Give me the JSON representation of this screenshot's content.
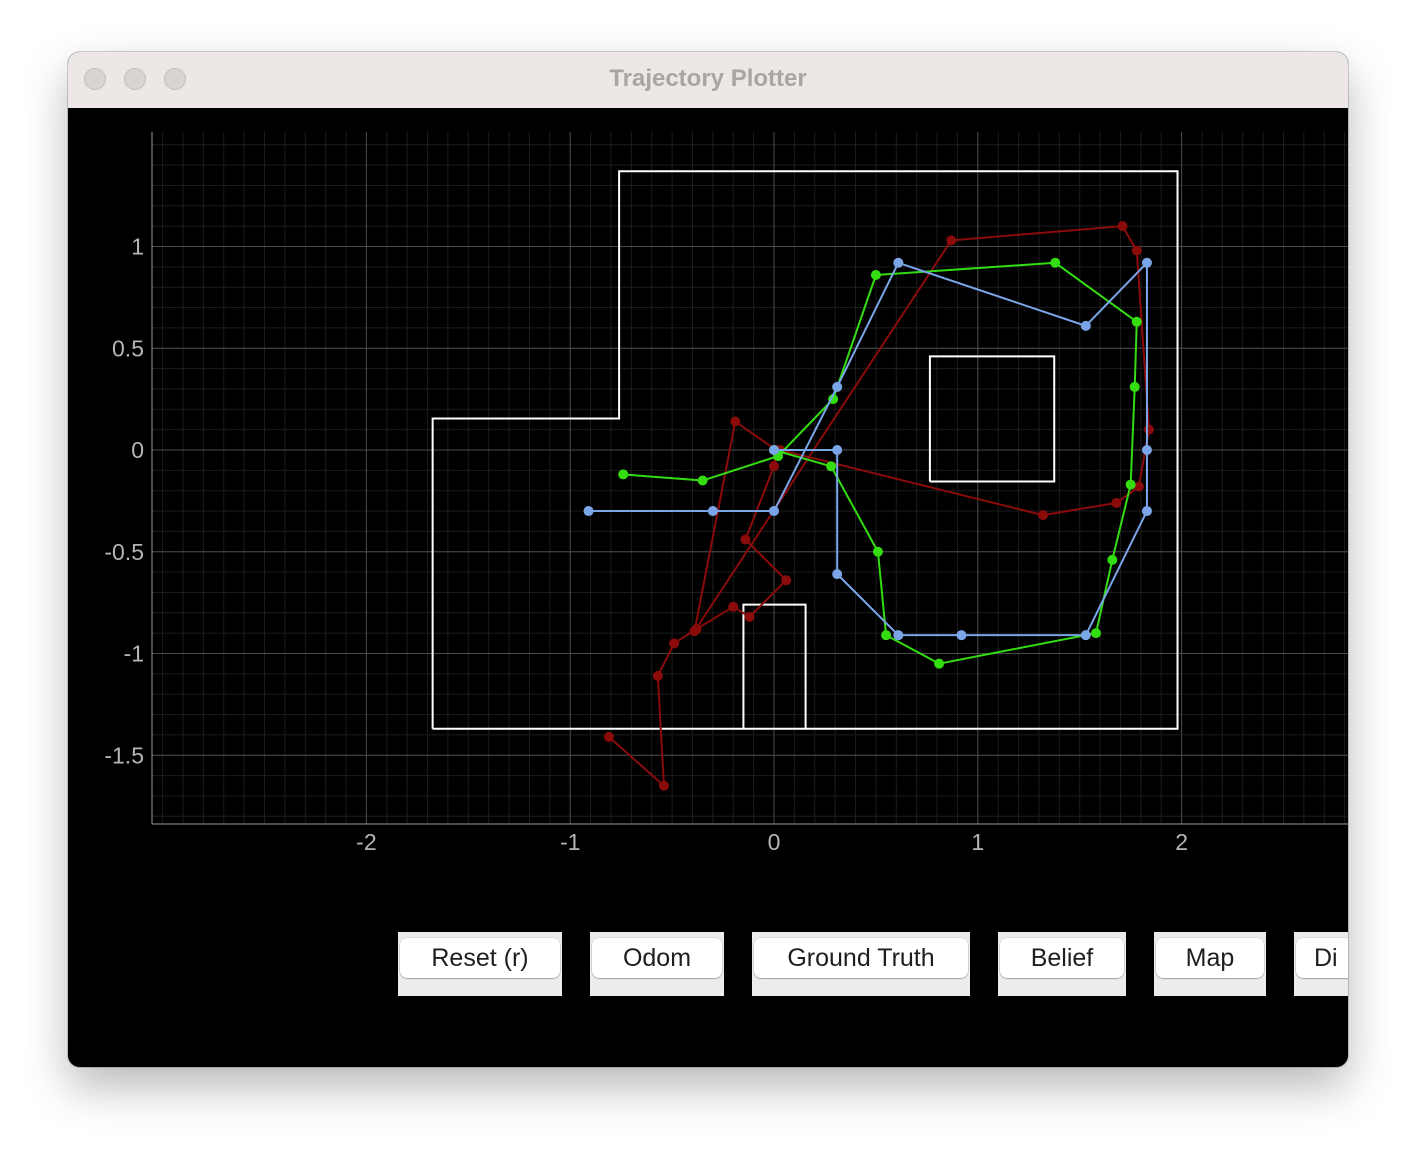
{
  "window": {
    "title": "Trajectory Plotter"
  },
  "colors": {
    "odom": "#8b0a0a",
    "ground_truth": "#33dd11",
    "belief": "#7aa6e8",
    "map": "#ffffff",
    "background": "#000000"
  },
  "buttons": {
    "reset": "Reset (r)",
    "odom": "Odom",
    "ground_truth": "Ground Truth",
    "belief": "Belief",
    "map": "Map",
    "distribution": "Di"
  },
  "chart_data": {
    "type": "line",
    "title": "",
    "xlabel": "",
    "ylabel": "",
    "xlim": [
      -3.0,
      2.8
    ],
    "ylim": [
      -1.83,
      1.55
    ],
    "grid": true,
    "x_ticks": [
      {
        "value": -2,
        "label": "-2"
      },
      {
        "value": -1,
        "label": "-1"
      },
      {
        "value": 0,
        "label": "0"
      },
      {
        "value": 1,
        "label": "1"
      },
      {
        "value": 2,
        "label": "2"
      }
    ],
    "y_ticks": [
      {
        "value": 1,
        "label": "1"
      },
      {
        "value": 0.5,
        "label": "0.5"
      },
      {
        "value": 0,
        "label": "0"
      },
      {
        "value": -0.5,
        "label": "-0.5"
      },
      {
        "value": -1,
        "label": "-1"
      },
      {
        "value": -1.5,
        "label": "-1.5"
      }
    ],
    "map_lines": [
      [
        [
          -1.675,
          -1.37
        ],
        [
          1.98,
          -1.37
        ],
        [
          1.98,
          1.37
        ],
        [
          -0.76,
          1.37
        ],
        [
          -0.76,
          0.155
        ],
        [
          -1.675,
          0.155
        ],
        [
          -1.675,
          -1.37
        ]
      ],
      [
        [
          0.765,
          -0.155
        ],
        [
          1.375,
          -0.155
        ],
        [
          1.375,
          0.46
        ],
        [
          0.765,
          0.46
        ],
        [
          0.765,
          -0.155
        ]
      ],
      [
        [
          -0.15,
          -1.37
        ],
        [
          -0.15,
          -0.76
        ],
        [
          0.155,
          -0.76
        ],
        [
          0.155,
          -1.37
        ]
      ]
    ],
    "series": [
      {
        "key": "odom",
        "points": [
          [
            -0.81,
            -1.41
          ],
          [
            -0.54,
            -1.65
          ],
          [
            -0.57,
            -1.11
          ],
          [
            -0.49,
            -0.95
          ],
          [
            -0.38,
            -0.88
          ],
          [
            -0.2,
            -0.77
          ],
          [
            -0.12,
            -0.82
          ],
          [
            0.06,
            -0.64
          ],
          [
            -0.14,
            -0.44
          ],
          [
            0.0,
            -0.08
          ],
          [
            0.01,
            0.0
          ],
          [
            -0.19,
            0.14
          ],
          [
            -0.39,
            -0.89
          ],
          [
            0.87,
            1.03
          ],
          [
            1.71,
            1.1
          ],
          [
            1.78,
            0.98
          ],
          [
            1.84,
            0.1
          ],
          [
            1.79,
            -0.18
          ],
          [
            1.68,
            -0.26
          ],
          [
            1.32,
            -0.32
          ],
          [
            0.03,
            0.0
          ]
        ]
      },
      {
        "key": "ground_truth",
        "points": [
          [
            -0.74,
            -0.12
          ],
          [
            -0.35,
            -0.15
          ],
          [
            0.02,
            -0.03
          ],
          [
            0.29,
            0.25
          ],
          [
            0.5,
            0.86
          ],
          [
            1.38,
            0.92
          ],
          [
            1.78,
            0.63
          ],
          [
            1.77,
            0.31
          ],
          [
            1.75,
            -0.17
          ],
          [
            1.66,
            -0.54
          ],
          [
            1.58,
            -0.9
          ],
          [
            0.81,
            -1.05
          ],
          [
            0.55,
            -0.91
          ],
          [
            0.51,
            -0.5
          ],
          [
            0.28,
            -0.08
          ],
          [
            0.0,
            0.0
          ]
        ]
      },
      {
        "key": "belief",
        "points": [
          [
            -0.91,
            -0.3
          ],
          [
            -0.3,
            -0.3
          ],
          [
            0.0,
            -0.3
          ],
          [
            0.31,
            0.31
          ],
          [
            0.61,
            0.92
          ],
          [
            1.53,
            0.61
          ],
          [
            1.83,
            0.92
          ],
          [
            1.83,
            0.0
          ],
          [
            1.83,
            -0.3
          ],
          [
            1.53,
            -0.91
          ],
          [
            0.92,
            -0.91
          ],
          [
            0.61,
            -0.91
          ],
          [
            0.31,
            -0.61
          ],
          [
            0.31,
            0.0
          ],
          [
            0.0,
            0.0
          ]
        ]
      }
    ]
  }
}
